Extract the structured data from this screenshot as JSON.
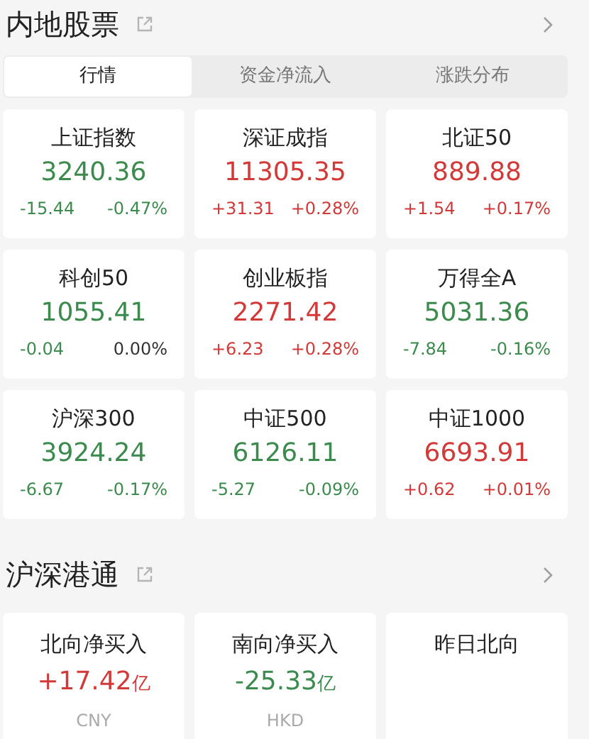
{
  "mainland": {
    "title": "内地股票",
    "tabs": [
      {
        "label": "行情",
        "selected": true
      },
      {
        "label": "资金净流入",
        "selected": false
      },
      {
        "label": "涨跌分布",
        "selected": false
      }
    ],
    "indices": [
      {
        "name": "上证指数",
        "value": {
          "text": "3240.36",
          "color": "#3d8a4f"
        },
        "change": {
          "text": "-15.44",
          "color": "#3d8a4f"
        },
        "percent": {
          "text": "-0.47%",
          "color": "#3d8a4f"
        }
      },
      {
        "name": "深证成指",
        "value": {
          "text": "11305.35",
          "color": "#d23a3a"
        },
        "change": {
          "text": "+31.31",
          "color": "#d23a3a"
        },
        "percent": {
          "text": "+0.28%",
          "color": "#d23a3a"
        }
      },
      {
        "name": "北证50",
        "value": {
          "text": "889.88",
          "color": "#d23a3a"
        },
        "change": {
          "text": "+1.54",
          "color": "#d23a3a"
        },
        "percent": {
          "text": "+0.17%",
          "color": "#d23a3a"
        }
      },
      {
        "name": "科创50",
        "value": {
          "text": "1055.41",
          "color": "#3d8a4f"
        },
        "change": {
          "text": "-0.04",
          "color": "#3d8a4f"
        },
        "percent": {
          "text": "0.00%",
          "color": "#333333"
        }
      },
      {
        "name": "创业板指",
        "value": {
          "text": "2271.42",
          "color": "#d23a3a"
        },
        "change": {
          "text": "+6.23",
          "color": "#d23a3a"
        },
        "percent": {
          "text": "+0.28%",
          "color": "#d23a3a"
        }
      },
      {
        "name": "万得全A",
        "value": {
          "text": "5031.36",
          "color": "#3d8a4f"
        },
        "change": {
          "text": "-7.84",
          "color": "#3d8a4f"
        },
        "percent": {
          "text": "-0.16%",
          "color": "#3d8a4f"
        }
      },
      {
        "name": "沪深300",
        "value": {
          "text": "3924.24",
          "color": "#3d8a4f"
        },
        "change": {
          "text": "-6.67",
          "color": "#3d8a4f"
        },
        "percent": {
          "text": "-0.17%",
          "color": "#3d8a4f"
        }
      },
      {
        "name": "中证500",
        "value": {
          "text": "6126.11",
          "color": "#3d8a4f"
        },
        "change": {
          "text": "-5.27",
          "color": "#3d8a4f"
        },
        "percent": {
          "text": "-0.09%",
          "color": "#3d8a4f"
        }
      },
      {
        "name": "中证1000",
        "value": {
          "text": "6693.91",
          "color": "#d23a3a"
        },
        "change": {
          "text": "+0.62",
          "color": "#d23a3a"
        },
        "percent": {
          "text": "+0.01%",
          "color": "#d23a3a"
        }
      }
    ]
  },
  "connect": {
    "title": "沪深港通",
    "cards": [
      {
        "title": "北向净买入",
        "amount": {
          "text": "+17.42",
          "unit": "亿",
          "color": "#d23a3a"
        },
        "currency": "CNY"
      },
      {
        "title": "南向净买入",
        "amount": {
          "text": "-25.33",
          "unit": "亿",
          "color": "#3d8a4f"
        },
        "currency": "HKD"
      },
      {
        "title": "昨日北向"
      }
    ]
  }
}
